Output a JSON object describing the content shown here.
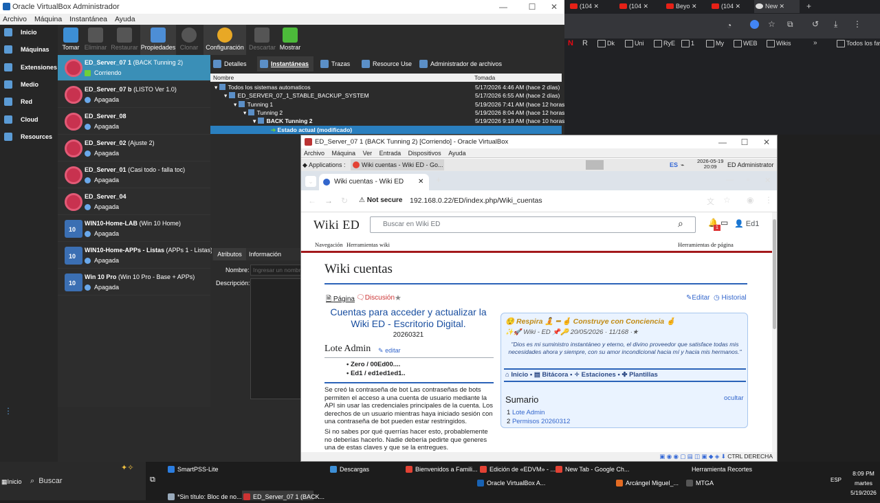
{
  "manager": {
    "title": "Oracle VirtualBox Administrador",
    "menu": [
      "Archivo",
      "Máquina",
      "Instantánea",
      "Ayuda"
    ],
    "nav": [
      "Inicio",
      "Máquinas",
      "Extensiones",
      "Medio",
      "Red",
      "Cloud",
      "Resources"
    ],
    "toolbar": [
      {
        "label": "Tomar",
        "state": "enabled"
      },
      {
        "label": "Eliminar",
        "state": "disabled"
      },
      {
        "label": "Restaurar",
        "state": "disabled"
      },
      {
        "label": "Propiedades",
        "state": "active"
      },
      {
        "label": "Clonar",
        "state": "disabled"
      },
      {
        "label": "Configuración",
        "state": "active"
      },
      {
        "label": "Descartar",
        "state": "disabled"
      },
      {
        "label": "Mostrar",
        "state": "enabled"
      }
    ],
    "vms": [
      {
        "name": "ED_Server_07 1",
        "desc": "(BACK Tunning 2)",
        "state": "Corriendo",
        "os": "linux"
      },
      {
        "name": "ED_Server_07 b",
        "desc": "(LISTO Ver 1.0)",
        "state": "Apagada",
        "os": "linux"
      },
      {
        "name": "ED_Server_08",
        "desc": "",
        "state": "Apagada",
        "os": "linux"
      },
      {
        "name": "ED_Server_02",
        "desc": "(Ajuste 2)",
        "state": "Apagada",
        "os": "linux"
      },
      {
        "name": "ED_Server_01",
        "desc": "(Casi todo - falla toc)",
        "state": "Apagada",
        "os": "linux"
      },
      {
        "name": "ED_Server_04",
        "desc": "",
        "state": "Apagada",
        "os": "linux"
      },
      {
        "name": "WIN10-Home-LAB",
        "desc": "(Win 10 Home)",
        "state": "Apagada",
        "os": "win"
      },
      {
        "name": "WIN10-Home-APPs - Listas",
        "desc": "(APPs 1 - Listas)",
        "state": "Apagada",
        "os": "win"
      },
      {
        "name": "Win 10 Pro",
        "desc": "(Win 10 Pro - Base + APPs)",
        "state": "Apagada",
        "os": "win"
      }
    ],
    "tabs": [
      "Detalles",
      "Instantáneas",
      "Trazas",
      "Resource Use",
      "Administrador de archivos"
    ],
    "snap_headers": [
      "Nombre",
      "Tomada"
    ],
    "snapshots": [
      {
        "name": "Todos los sistemas automaticos",
        "date": "5/17/2026 4:46 AM (hace 2 días)"
      },
      {
        "name": "ED_SERVER_07_1_STABLE_BACKUP_SYSTEM",
        "date": "5/17/2026 6:55 AM (hace 2 días)"
      },
      {
        "name": "Tunning 1",
        "date": "5/19/2026 7:41 AM (hace 12 horas)"
      },
      {
        "name": "Tunning 2",
        "date": "5/19/2026 8:04 AM (hace 12 horas)"
      },
      {
        "name": "BACK Tunning 2",
        "date": "5/19/2026 9:18 AM (hace 10 horas)"
      },
      {
        "name": "Estado actual (modificado)",
        "date": ""
      }
    ],
    "attr_tabs": [
      "Atributos",
      "Información"
    ],
    "attr_name_label": "Nombre:",
    "attr_name_placeholder": "Ingresar un nombr",
    "attr_desc_label": "Descripción:"
  },
  "chrome": {
    "tabs": [
      "(104",
      "(104",
      "Beyo",
      "(104",
      "New"
    ],
    "bookmarks": [
      "Dk",
      "Uni",
      "RyE",
      "1",
      "My",
      "WEB",
      "Wikis",
      "Todos los fav"
    ]
  },
  "guest": {
    "title": "ED_Server_07 1 (BACK Tunning 2) [Corriendo] - Oracle VirtualBox",
    "menu": [
      "Archivo",
      "Máquina",
      "Ver",
      "Entrada",
      "Dispositivos",
      "Ayuda"
    ],
    "xfce_apps": "Applications :",
    "xfce_window": "Wiki cuentas - Wiki ED - Go...",
    "xfce_lang": "ES",
    "xfce_date": "2026-05-19",
    "xfce_time": "20:09",
    "xfce_user": "ED Administrator",
    "tab_title": "Wiki cuentas - Wiki ED",
    "not_secure": "Not secure",
    "url": "192.168.0.22/ED/index.php/Wiki_cuentas",
    "status": "CTRL DERECHA",
    "wiki": {
      "logo": "Wiki ED",
      "search_placeholder": "Buscar en Wiki ED",
      "user": "Ed1",
      "notif": "1",
      "nav": "Navegación",
      "tools": "Herramientas wiki",
      "page_tools": "Herramientas de página",
      "title": "Wiki cuentas",
      "page_tab": "Página",
      "talk_tab": "Discusión",
      "edit": "Editar",
      "history": "Historial",
      "heading": "Cuentas para acceder y actualizar la Wiki ED - Escritorio Digital.",
      "date": "20260321",
      "section": "Lote Admin",
      "section_edit": "editar",
      "items": [
        "Zero / 00Ed00....",
        "Ed1 / ed1ed1ed1.."
      ],
      "para1": "Se creó la contraseña de bot Las contraseñas de bots permiten el acceso a una cuenta de usuario mediante la API sin usar las credenciales principales de la cuenta. Los derechos de un usuario mientras haya iniciado sesión con una contraseña de bot pueden estar restringidos.",
      "para2": "Si no sabes por qué querrías hacer esto, probablemente no deberías hacerlo. Nadie debería pedirte que generes una de estas claves y que se la entregues.",
      "box_line1": "😌 Respira 🧘 ━ 🤞 Construye con Conciencia 🤞",
      "box_line2": "✨🚀 Wiki - ED 📌🔑 20/05/2026 · 11/168 ·★",
      "box_quote": "\"Dios es mi suministro instantáneo y eterno, el divino proveedor que satisface todas mis necesidades ahora y siempre, con su amor incondicional hacia mí y hacia mis hermanos.\"",
      "box_links": [
        "Inicio",
        "Bitácora",
        "Estaciones",
        "Plantillas"
      ],
      "toc_title": "Sumario",
      "toc_hide": "ocultar",
      "toc": [
        {
          "n": "1",
          "t": "Lote Admin"
        },
        {
          "n": "2",
          "t": "Permisos 20260312"
        }
      ]
    }
  },
  "taskbar": {
    "start": "Inicio",
    "search": "Buscar",
    "row1": [
      "SmartPSS-Lite",
      "Descargas",
      "Bienvenidos a Famili...",
      "Edición de «EDVM» - ...",
      "New Tab - Google Ch...",
      "Herramienta Recortes"
    ],
    "row2": [
      "*Sin título: Bloc de no...",
      "ED_Server_07 1 (BACK...",
      "Oracle VirtualBox A...",
      "Arcángel Miguel_...",
      "MTGA"
    ],
    "clock_time": "8:09 PM",
    "clock_day": "martes",
    "clock_date": "5/19/2026",
    "lang": "ESP"
  }
}
